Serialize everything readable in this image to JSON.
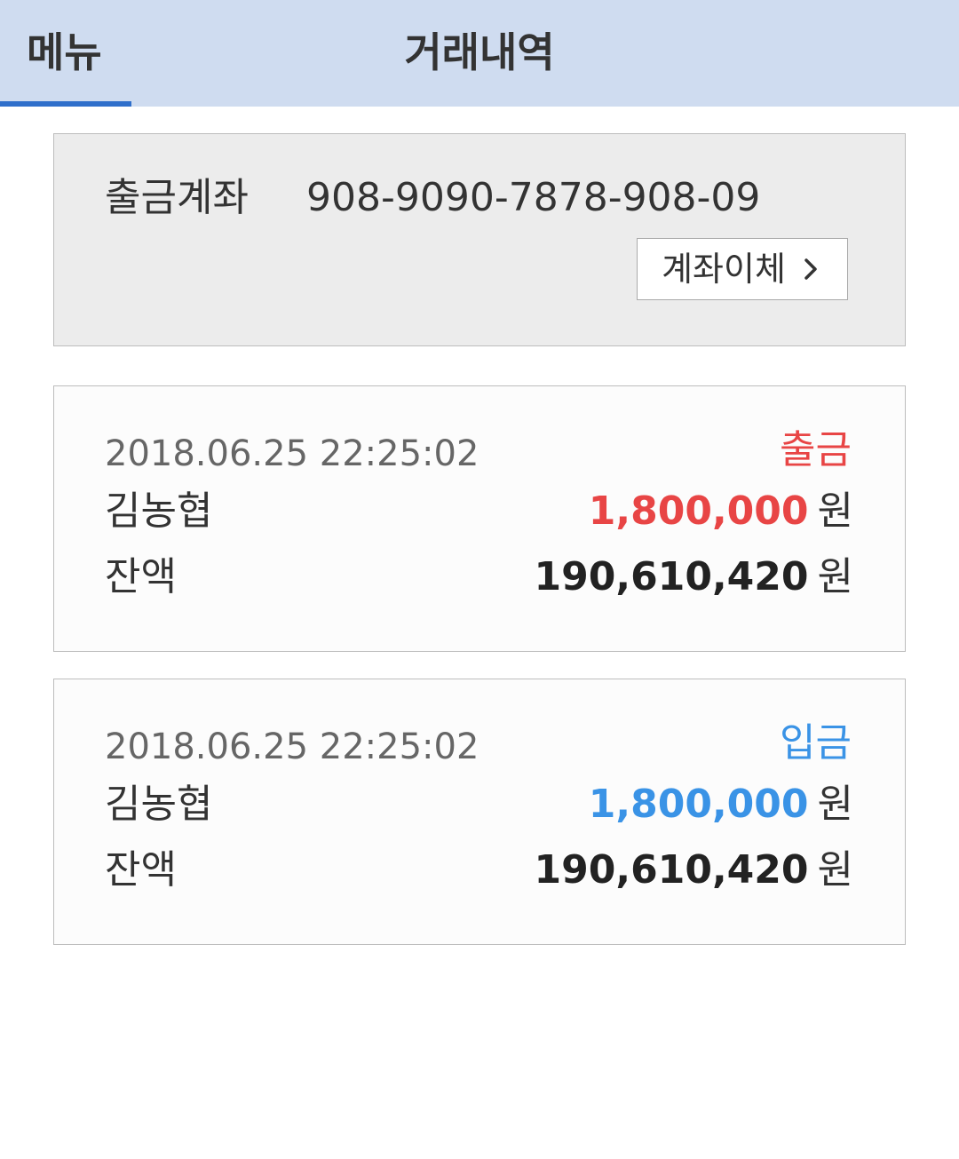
{
  "header": {
    "menu_label": "메뉴",
    "title": "거래내역",
    "accent_color": "#2f6fcb",
    "background_color": "#cfdcf0"
  },
  "account": {
    "label": "출금계좌",
    "number": "908-9090-7878-908-09",
    "transfer_button_label": "계좌이체",
    "transfer_button_icon": "chevron-right-icon"
  },
  "transactions": [
    {
      "datetime": "2018.06.25  22:25:02",
      "type": "출금",
      "type_color": "#e84545",
      "name": "김농협",
      "amount": "1,800,000",
      "amount_unit": "원",
      "balance_label": "잔액",
      "balance": "190,610,420",
      "balance_unit": "원"
    },
    {
      "datetime": "2018.06.25  22:25:02",
      "type": "입금",
      "type_color": "#3a93e6",
      "name": "김농협",
      "amount": "1,800,000",
      "amount_unit": "원",
      "balance_label": "잔액",
      "balance": "190,610,420",
      "balance_unit": "원"
    }
  ]
}
